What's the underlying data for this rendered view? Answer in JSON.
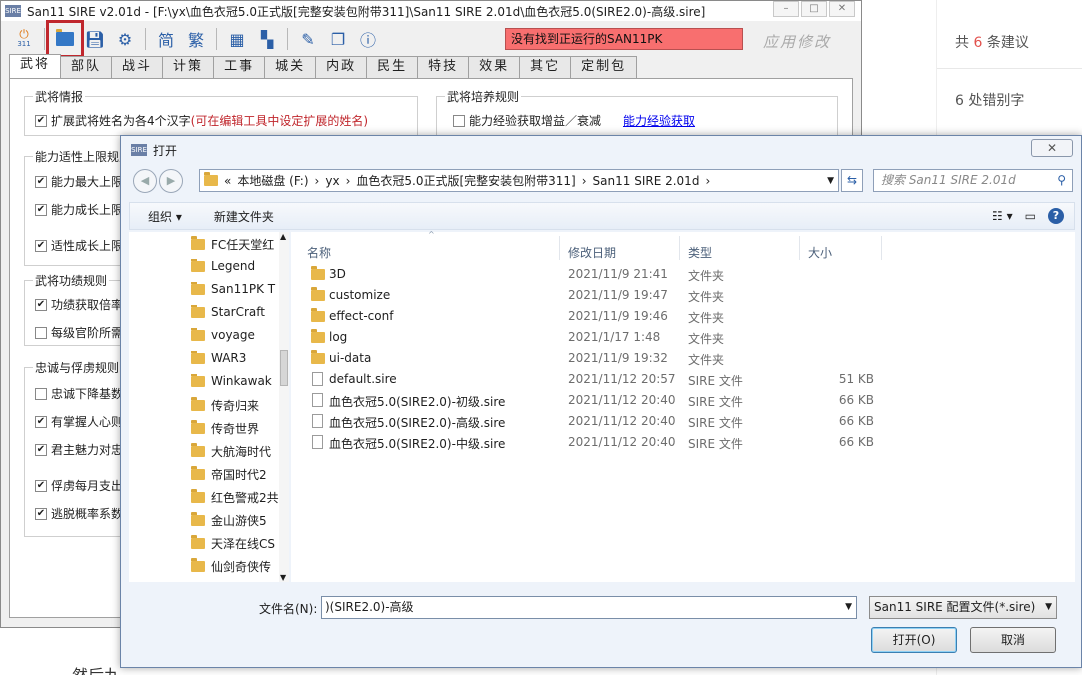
{
  "app": {
    "title": "San11 SIRE v2.01d - [F:\\yx\\血色衣冠5.0正式版[完整安装包附带311]\\San11 SIRE 2.01d\\血色衣冠5.0(SIRE2.0)-高级.sire]",
    "logo_text": "SIRE",
    "toolbar_icon_badge": "311",
    "simplified_label": "简",
    "traditional_label": "繁",
    "status_text": "没有找到正运行的SAN11PK",
    "apply_label": "应用修改",
    "tabs": [
      "武将",
      "部队",
      "战斗",
      "计策",
      "工事",
      "城关",
      "内政",
      "民生",
      "特技",
      "效果",
      "其它",
      "定制包"
    ],
    "groups": {
      "general_info": "武将情报",
      "ability_limit": "能力适性上限规则",
      "merit": "武将功绩规则",
      "loyalty": "忠诚与俘虏规则",
      "training": "武将培养规则"
    },
    "options": {
      "extend_name_prefix": "扩展武将姓名为各4个汉字 ",
      "extend_name_note": "(可在编辑工具中设定扩展的姓名)",
      "ability_max": "能力最大上限",
      "ability_growth": "能力成长上限",
      "aptitude_growth": "适性成长上限",
      "merit_rate": "功绩获取倍率",
      "rank_required": "每级官阶所需",
      "loyalty_drop": "忠诚下降基数",
      "popularity": "有掌握人心则",
      "lord_charisma": "君主魅力对忠",
      "captive_cost": "俘虏每月支出",
      "escape_rate": "逃脱概率系数",
      "exp_gain": "能力经验获取增益／衰减",
      "exp_link": "能力经验获取"
    }
  },
  "dialog": {
    "title": "打开",
    "close_label": "✕",
    "breadcrumb": [
      "«",
      "本地磁盘 (F:)",
      "yx",
      "血色衣冠5.0正式版[完整安装包附带311]",
      "San11 SIRE 2.01d"
    ],
    "search_placeholder": "搜索 San11 SIRE 2.01d",
    "organize_label": "组织 ▾",
    "new_folder_label": "新建文件夹",
    "help_label": "?",
    "tree": [
      "FC任天堂红",
      "Legend",
      "San11PK T",
      "StarCraft",
      "voyage",
      "WAR3",
      "Winkawak",
      "传奇归来",
      "传奇世界",
      "大航海时代",
      "帝国时代2",
      "红色警戒2共",
      "金山游侠5",
      "天泽在线CS",
      "仙剑奇侠传"
    ],
    "columns": [
      "名称",
      "修改日期",
      "类型",
      "大小"
    ],
    "files": [
      {
        "name": "3D",
        "date": "2021/11/9 21:41",
        "type": "文件夹",
        "size": "",
        "kind": "folder"
      },
      {
        "name": "customize",
        "date": "2021/11/9 19:47",
        "type": "文件夹",
        "size": "",
        "kind": "folder"
      },
      {
        "name": "effect-conf",
        "date": "2021/11/9 19:46",
        "type": "文件夹",
        "size": "",
        "kind": "folder"
      },
      {
        "name": "log",
        "date": "2021/1/17 1:48",
        "type": "文件夹",
        "size": "",
        "kind": "folder"
      },
      {
        "name": "ui-data",
        "date": "2021/11/9 19:32",
        "type": "文件夹",
        "size": "",
        "kind": "folder"
      },
      {
        "name": "default.sire",
        "date": "2021/11/12 20:57",
        "type": "SIRE 文件",
        "size": "51 KB",
        "kind": "file"
      },
      {
        "name": "血色衣冠5.0(SIRE2.0)-初级.sire",
        "date": "2021/11/12 20:40",
        "type": "SIRE 文件",
        "size": "66 KB",
        "kind": "file"
      },
      {
        "name": "血色衣冠5.0(SIRE2.0)-高级.sire",
        "date": "2021/11/12 20:40",
        "type": "SIRE 文件",
        "size": "66 KB",
        "kind": "file"
      },
      {
        "name": "血色衣冠5.0(SIRE2.0)-中级.sire",
        "date": "2021/11/12 20:40",
        "type": "SIRE 文件",
        "size": "66 KB",
        "kind": "file"
      }
    ],
    "filename_label": "文件名(N):",
    "filename_value": ")(SIRE2.0)-高级",
    "filetype_value": "San11 SIRE 配置文件(*.sire)",
    "open_label": "打开(O)",
    "cancel_label": "取消"
  },
  "sidebar": {
    "suggest_prefix": "共 ",
    "suggest_count": "6",
    "suggest_suffix": " 条建议",
    "typos": "6 处错别字"
  },
  "footer_text": "然后九"
}
